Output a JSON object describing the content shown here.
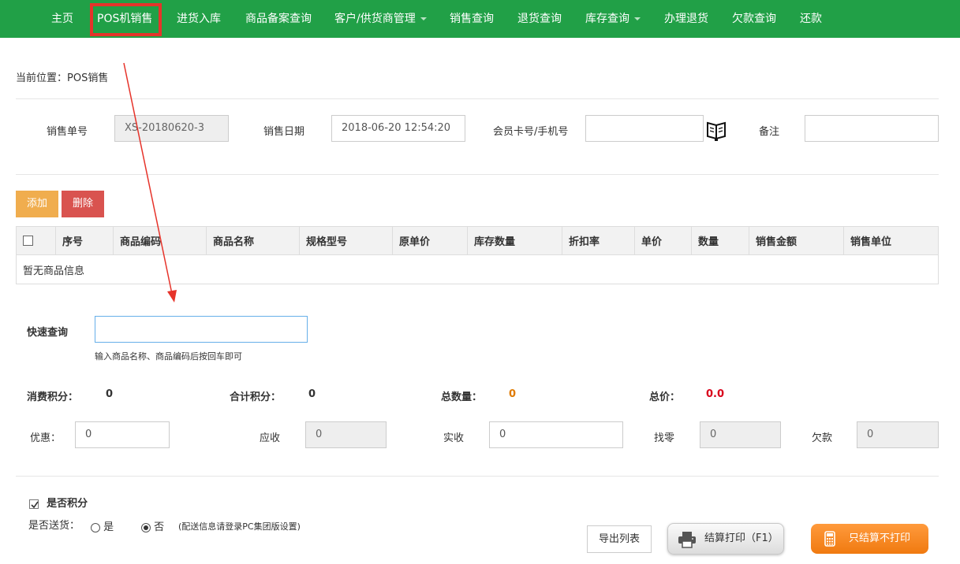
{
  "nav": {
    "items": [
      {
        "label": "主页"
      },
      {
        "label": "POS机销售"
      },
      {
        "label": "进货入库"
      },
      {
        "label": "商品备案查询"
      },
      {
        "label": "客户/供货商管理"
      },
      {
        "label": "销售查询"
      },
      {
        "label": "退货查询"
      },
      {
        "label": "库存查询"
      },
      {
        "label": "办理退货"
      },
      {
        "label": "欠款查询"
      },
      {
        "label": "还款"
      }
    ]
  },
  "breadcrumb": "当前位置：POS销售",
  "header_form": {
    "order_no_label": "销售单号",
    "order_no_value": "XS-20180620-3",
    "date_label": "销售日期",
    "date_value": "2018-06-20 12:54:20",
    "member_label": "会员卡号/手机号",
    "member_value": "",
    "remark_label": "备注",
    "remark_value": ""
  },
  "toolbar": {
    "add_label": "添加",
    "delete_label": "删除"
  },
  "table": {
    "columns": [
      "序号",
      "商品编码",
      "商品名称",
      "规格型号",
      "原单价",
      "库存数量",
      "折扣率",
      "单价",
      "数量",
      "销售金额",
      "销售单位"
    ],
    "empty_text": "暂无商品信息"
  },
  "quick_search": {
    "label": "快速查询",
    "value": "",
    "hint": "输入商品名称、商品编码后按回车即可"
  },
  "summary": {
    "points_label": "消费积分：",
    "points_value": "0",
    "total_points_label": "合计积分：",
    "total_points_value": "0",
    "total_qty_label": "总数量：",
    "total_qty_value": "0",
    "total_price_label": "总价：",
    "total_price_value": "0.0"
  },
  "payment": {
    "discount_label": "优惠：",
    "discount_value": "0",
    "receivable_label": "应收",
    "receivable_value": "0",
    "received_label": "实收",
    "received_value": "0",
    "change_label": "找零",
    "change_value": "0",
    "debt_label": "欠款",
    "debt_value": "0"
  },
  "options": {
    "points_label": "是否积分",
    "points_checked": true,
    "delivery_label": "是否送货：",
    "delivery_yes": "是",
    "delivery_no": "否",
    "delivery_selected": "否",
    "delivery_note": "(配送信息请登录PC集团版设置)"
  },
  "actions": {
    "export_label": "导出列表",
    "print_label": "结算打印（F1）",
    "settle_label": "只结算不打印"
  },
  "colors": {
    "nav_bg": "#21a047",
    "highlight": "#e6332a",
    "qty_value": "#e07b00",
    "price_value": "#d9001b",
    "add_button": "#f0ad4e",
    "delete_button": "#d9534f",
    "settle_button": "#f08a20"
  }
}
